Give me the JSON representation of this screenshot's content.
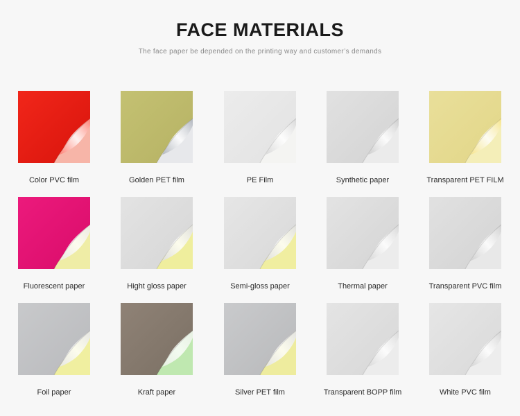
{
  "header": {
    "title": "FACE MATERIALS",
    "subtitle": "The face paper be depended on the printing way and customer’s demands"
  },
  "materials": [
    {
      "label": "Color PVC film",
      "face": "#f1261a",
      "face2": "#d8140c",
      "liner": "#f7b5a8",
      "curl": "#ff7e72"
    },
    {
      "label": "Golden PET film",
      "face": "#c4c172",
      "face2": "#b6b264",
      "liner": "#e7e8eb",
      "curl": "#aeb3bb"
    },
    {
      "label": "PE Film",
      "face": "#ececec",
      "face2": "#e2e2e2",
      "liner": "#f4f4f2",
      "curl": "#d8d8d8"
    },
    {
      "label": "Synthetic paper",
      "face": "#e1e1e1",
      "face2": "#d3d3d3",
      "liner": "#ebebeb",
      "curl": "#cccccc"
    },
    {
      "label": "Transparent PET FILM",
      "face": "#e9df9a",
      "face2": "#e2d688",
      "liner": "#f4eeb8",
      "curl": "#f6e48a"
    },
    {
      "label": "Fluorescent paper",
      "face": "#ec1a7c",
      "face2": "#d90c6a",
      "liner": "#efeda6",
      "curl": "#eceae4"
    },
    {
      "label": "Hight gloss paper",
      "face": "#e3e3e3",
      "face2": "#d6d6d6",
      "liner": "#efee9d",
      "curl": "#dedede"
    },
    {
      "label": "Semi-gloss paper",
      "face": "#e6e6e6",
      "face2": "#d8d8d8",
      "liner": "#f0eea0",
      "curl": "#dfdfdf"
    },
    {
      "label": "Thermal paper",
      "face": "#e3e3e3",
      "face2": "#d4d4d4",
      "liner": "#ececec",
      "curl": "#d6d6d6"
    },
    {
      "label": "Transparent PVC film",
      "face": "#e1e1e1",
      "face2": "#d3d3d3",
      "liner": "#e8e8e8",
      "curl": "#cfcfcf"
    },
    {
      "label": "Foil paper",
      "face": "#c8c9cb",
      "face2": "#b9babd",
      "liner": "#f0efa0",
      "curl": "#e6e6e6"
    },
    {
      "label": "Kraft paper",
      "face": "#8f8276",
      "face2": "#7b7064",
      "liner": "#bfe8b0",
      "curl": "#e8f0e4"
    },
    {
      "label": "Silver PET film",
      "face": "#c9cacc",
      "face2": "#b8b9bb",
      "liner": "#eeec9e",
      "curl": "#e3e3e3"
    },
    {
      "label": "Transparent BOPP film",
      "face": "#e4e4e4",
      "face2": "#d7d7d7",
      "liner": "#ececec",
      "curl": "#d9d9d9"
    },
    {
      "label": "White PVC film",
      "face": "#e6e6e6",
      "face2": "#d9d9d9",
      "liner": "#ededed",
      "curl": "#d3d3d3"
    }
  ]
}
